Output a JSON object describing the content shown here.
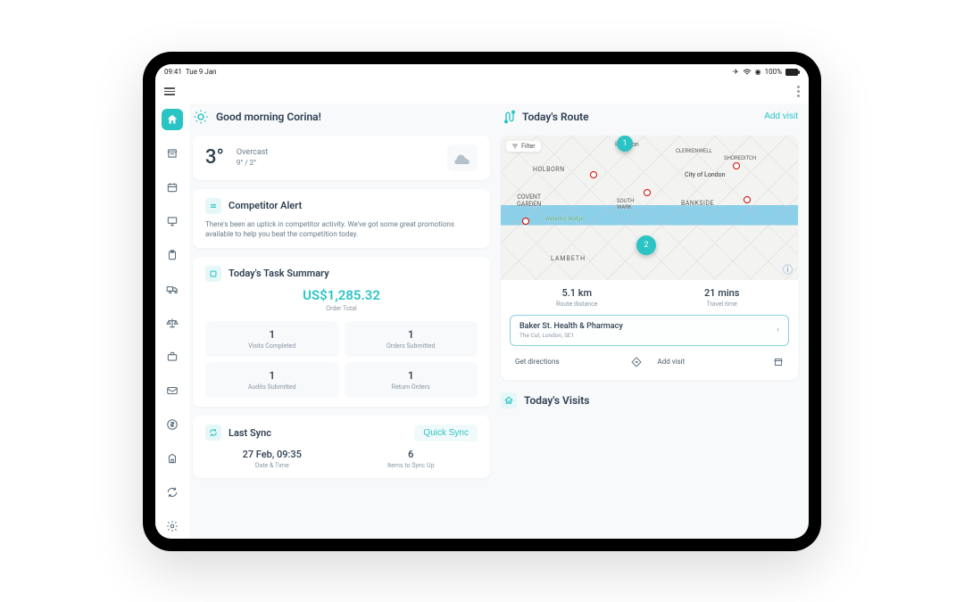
{
  "status": {
    "time": "09:41",
    "date": "Tue 9 Jan",
    "battery": "100%"
  },
  "user": {
    "greeting": "Good morning Corina!"
  },
  "weather": {
    "temp": "3°",
    "condition": "Overcast",
    "hilo": "9° / 2°"
  },
  "alert": {
    "title": "Competitor Alert",
    "text": "There's been an uptick in competitor activity. We've got some great promotions available to help you beat the competition today."
  },
  "task": {
    "title": "Today's Task Summary",
    "order_total": "US$1,285.32",
    "order_total_label": "Order Total",
    "stats": [
      {
        "num": "1",
        "lbl": "Visits Completed"
      },
      {
        "num": "1",
        "lbl": "Orders Submitted"
      },
      {
        "num": "1",
        "lbl": "Audits Submitted"
      },
      {
        "num": "1",
        "lbl": "Return Orders"
      }
    ]
  },
  "sync": {
    "title": "Last Sync",
    "quick_sync": "Quick Sync",
    "datetime": "27 Feb, 09:35",
    "datetime_label": "Date & Time",
    "items_count": "6",
    "items_label": "Items to Sync Up"
  },
  "route": {
    "title": "Today's Route",
    "add_visit": "Add visit",
    "filter": "Filter",
    "distance": "5.1 km",
    "distance_label": "Route distance",
    "travel_time": "21 mins",
    "travel_time_label": "Travel time",
    "next_visit_name": "Baker St. Health & Pharmacy",
    "next_visit_addr": "The Cut, London, SE1",
    "get_directions": "Get directions",
    "add_visit2": "Add visit",
    "labels": {
      "islington": "Islington",
      "city": "City of London",
      "lambeth": "LAMBETH",
      "covent": "COVENT\nGARDEN",
      "bankside": "BANKSIDE",
      "holborn": "HOLBORN",
      "clerkenwell": "CLERKENWELL",
      "shoreditch": "SHOREDITCH",
      "southwark": "SOUTH\nWARK",
      "waterloo": "Waterloo Bridge"
    }
  },
  "visits": {
    "title": "Today's Visits"
  }
}
